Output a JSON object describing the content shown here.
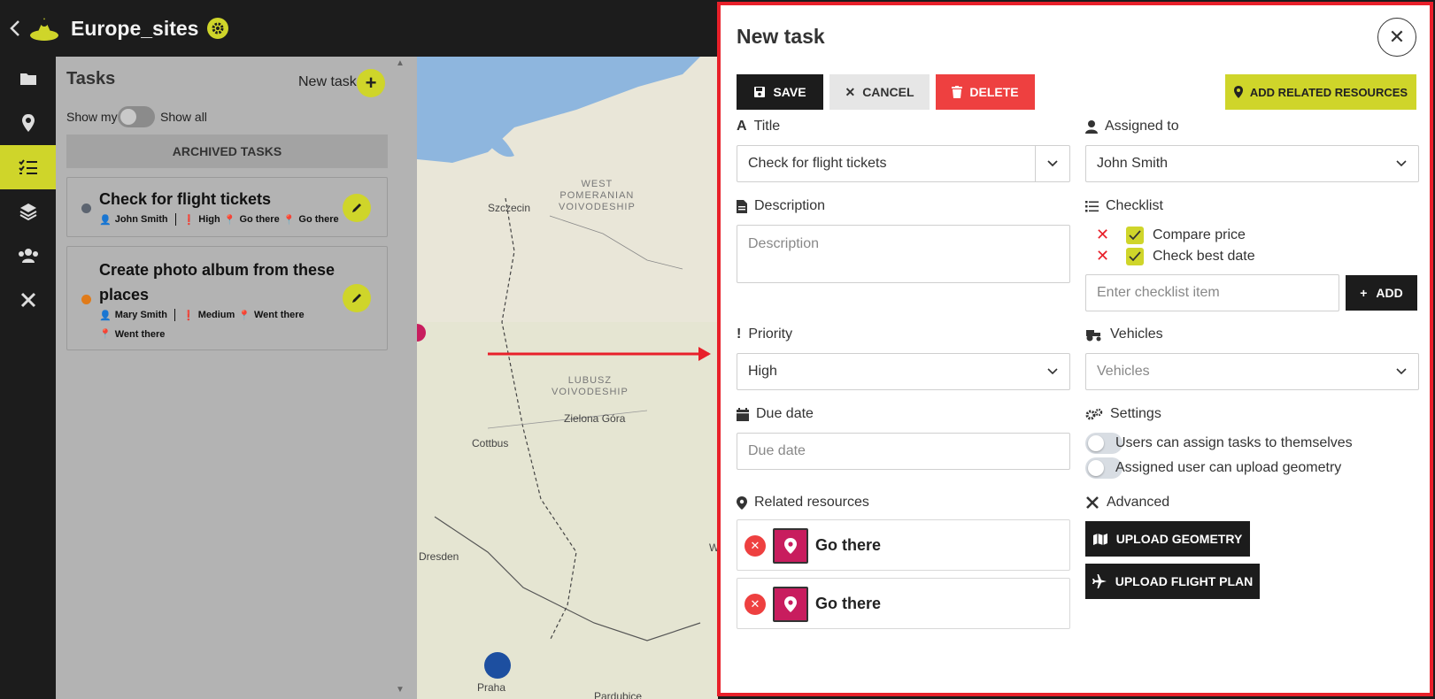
{
  "app": {
    "title": "Europe_sites"
  },
  "colors": {
    "accent": "#cfd52a",
    "danger": "#ee4040",
    "dark": "#1c1c1c",
    "resource": "#c81d5e",
    "highlight_border": "#e8202a"
  },
  "sidebar": {
    "items": [
      {
        "icon": "folder-icon"
      },
      {
        "icon": "map-pin-icon"
      },
      {
        "icon": "tasks-icon",
        "active": true
      },
      {
        "icon": "layers-icon"
      },
      {
        "icon": "users-icon"
      },
      {
        "icon": "tools-icon"
      }
    ]
  },
  "tasks_panel": {
    "header": "Tasks",
    "new_task_label": "New task",
    "show_my": "Show my",
    "show_all": "Show all",
    "archived": "ARCHIVED TASKS",
    "tasks": [
      {
        "title": "Check for flight tickets",
        "assignee": "John Smith",
        "priority": "High",
        "resources": [
          "Go there",
          "Go there"
        ],
        "dot_color": "#5c6470"
      },
      {
        "title_line1": "Create photo album from these",
        "title_line2": "places",
        "assignee": "Mary Smith",
        "priority": "Medium",
        "resources": [
          "Went there",
          "Went there"
        ],
        "dot_color": "#e07b1a"
      }
    ]
  },
  "map": {
    "labels": {
      "szczecin": "Szczecin",
      "west_pom": [
        "WEST",
        "POMERANIAN",
        "VOIVODESHIP"
      ],
      "lubusz": [
        "LUBUSZ",
        "VOIVODESHIP"
      ],
      "zielona": "Zielona Góra",
      "cottbus": "Cottbus",
      "dresden": "Dresden",
      "pardubice": "Pardubice",
      "praha": "Praha",
      "w_fragment": "W"
    }
  },
  "dialog": {
    "title": "New task",
    "buttons": {
      "save": "SAVE",
      "cancel": "CANCEL",
      "delete": "DELETE",
      "add_related": "ADD RELATED RESOURCES"
    },
    "title_label": "Title",
    "title_value": "Check for flight tickets",
    "assigned_label": "Assigned to",
    "assigned_value": "John Smith",
    "description_label": "Description",
    "description_placeholder": "Description",
    "checklist_label": "Checklist",
    "checklist_items": [
      "Compare price",
      "Check best date"
    ],
    "checklist_placeholder": "Enter checklist item",
    "checklist_add": "ADD",
    "priority_label": "Priority",
    "priority_value": "High",
    "vehicles_label": "Vehicles",
    "vehicles_placeholder": "Vehicles",
    "due_label": "Due date",
    "due_placeholder": "Due date",
    "settings_label": "Settings",
    "settings": [
      "Users can assign tasks to themselves",
      "Assigned user can upload geometry"
    ],
    "related_label": "Related resources",
    "related": [
      "Go there",
      "Go there"
    ],
    "advanced_label": "Advanced",
    "upload_geometry": "UPLOAD GEOMETRY",
    "upload_flight": "UPLOAD FLIGHT PLAN"
  }
}
